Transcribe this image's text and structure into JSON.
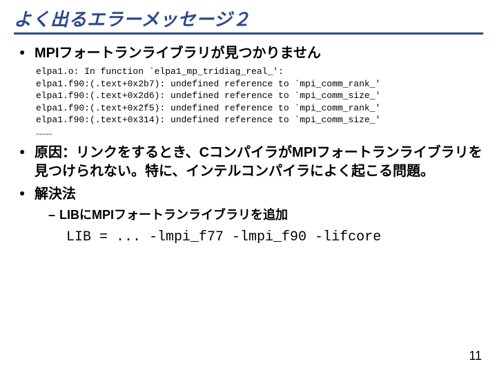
{
  "title": "よく出るエラーメッセージ２",
  "bullets": {
    "b1": "MPIフォートランライブラリが見つかりません",
    "code": "elpa1.o: In function `elpa1_mp_tridiag_real_':\nelpa1.f90:(.text+0x2b7): undefined reference to `mpi_comm_rank_'\nelpa1.f90:(.text+0x2d6): undefined reference to `mpi_comm_size_'\nelpa1.f90:(.text+0x2f5): undefined reference to `mpi_comm_rank_'\nelpa1.f90:(.text+0x314): undefined reference to `mpi_comm_size_'\n………",
    "b2": "原因：リンクをするとき、CコンパイラがMPIフォートランライブラリを見つけられない。特に、インテルコンパイラによく起こる問題。",
    "b3": "解決法",
    "sub1": "LIBにMPIフォートランライブラリを追加",
    "cmd": "LIB = ... -lmpi_f77 -lmpi_f90 -lifcore"
  },
  "page_number": "11"
}
